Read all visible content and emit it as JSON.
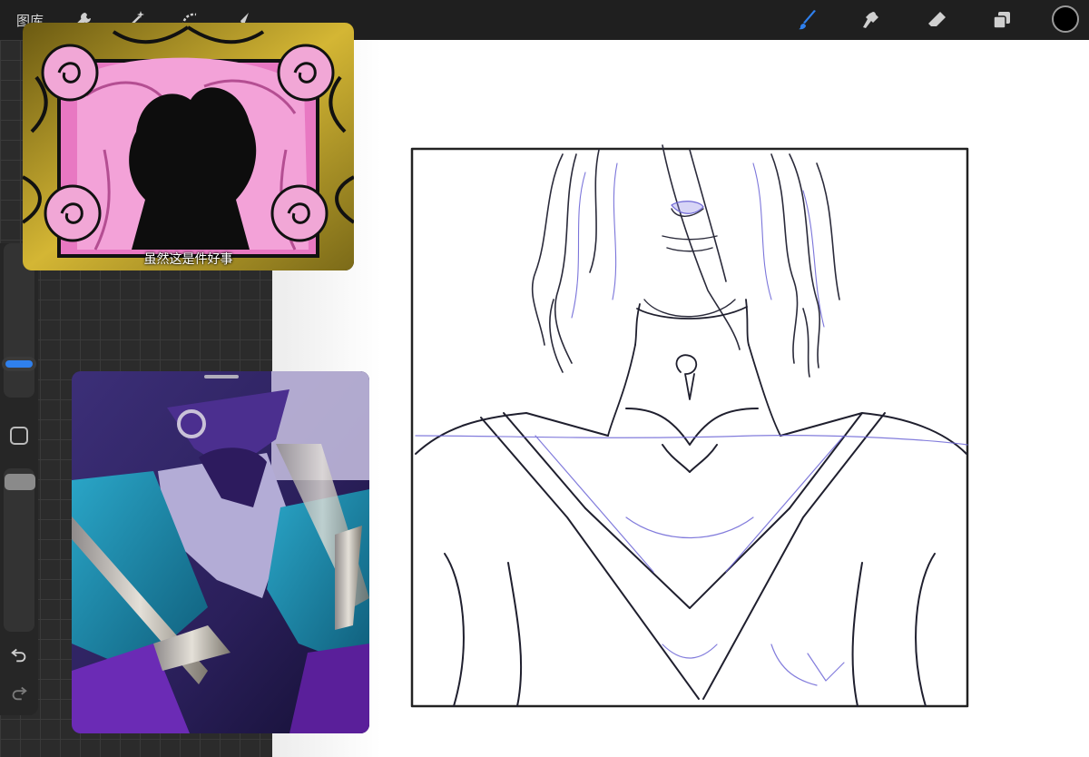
{
  "toolbar": {
    "gallery_label": "图库",
    "left_tools": [
      "wrench-icon",
      "magic-wand-icon",
      "selection-icon",
      "transform-arrow-icon"
    ],
    "right_tools": [
      "brush-icon",
      "smudge-icon",
      "eraser-icon",
      "layers-icon"
    ],
    "active_tool": "brush-icon",
    "accent_color": "#2f80ed",
    "current_color": "#000000"
  },
  "sidebar": {
    "brush_size_level": 0.15,
    "opacity_level": 0.05,
    "undo_icon": "undo-icon",
    "redo_icon": "redo-icon"
  },
  "reference_1": {
    "caption": "虽然这是件好事"
  },
  "canvas": {
    "background": "#ffffff",
    "line_color_primary": "#1a1a2e",
    "line_color_secondary": "#6a60d8"
  }
}
